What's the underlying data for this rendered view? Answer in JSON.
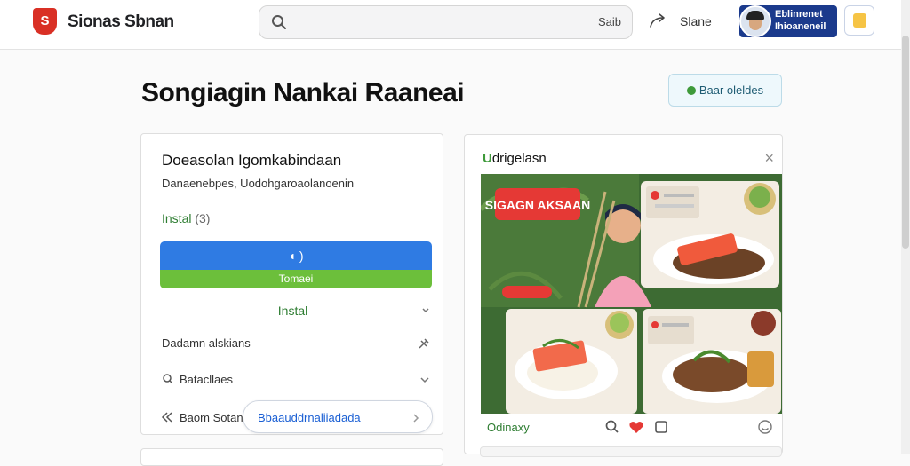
{
  "header": {
    "logo_text": "S",
    "brand": "Sionas Sbnan",
    "search_placeholder": "",
    "search_button": "Saib",
    "share_label": "Slane",
    "profile_name": "Eblinrenet",
    "profile_sub": "Ihioaneneil"
  },
  "page": {
    "title": "Songiagin Nankai Raaneai",
    "action_button": "Baar oleldes"
  },
  "left_card": {
    "title": "Doeasolan Igomkabindaan",
    "subtitle": "Danaenebpes, Uodohgaroaolanoenin",
    "install_label": "Instal",
    "install_count": "(3)",
    "primary_button": "◖ )",
    "secondary_button": "Tomaei",
    "install_section": "Instal",
    "rows": [
      {
        "label": "Dadamn alskians"
      },
      {
        "label": "Batacllaes"
      },
      {
        "label": "Baom Sotan"
      }
    ],
    "pill_text": "Bbaauddrnaliiadada"
  },
  "right_card": {
    "title_lead": "U",
    "title_rest": "drigelasn",
    "poster_text": "SIGAGN AKSAAN",
    "footer_left": "Odinaxy",
    "accent": "#e53935"
  }
}
